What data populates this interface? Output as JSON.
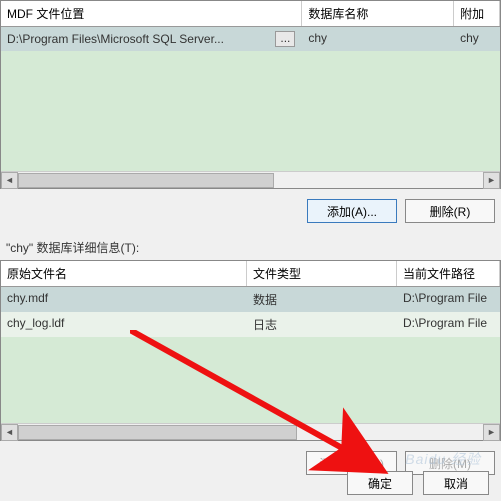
{
  "topGrid": {
    "headers": {
      "mdf": "MDF 文件位置",
      "dbname": "数据库名称",
      "attach": "附加"
    },
    "row": {
      "path": "D:\\Program Files\\Microsoft SQL Server...",
      "browse": "...",
      "dbname": "chy",
      "attach": "chy"
    }
  },
  "buttons": {
    "add": "添加(A)...",
    "remove": "删除(R)",
    "addDir": "添加目录(C)",
    "removeM": "删除(M)",
    "ok": "确定",
    "cancel": "取消"
  },
  "detailLabel": "\"chy\" 数据库详细信息(T):",
  "detailGrid": {
    "headers": {
      "fname": "原始文件名",
      "ftype": "文件类型",
      "fpath": "当前文件路径"
    },
    "rows": [
      {
        "fname": "chy.mdf",
        "ftype": "数据",
        "fpath": "D:\\Program File"
      },
      {
        "fname": "chy_log.ldf",
        "ftype": "日志",
        "fpath": "D:\\Program File"
      }
    ]
  },
  "watermark": "Baidu 经验"
}
